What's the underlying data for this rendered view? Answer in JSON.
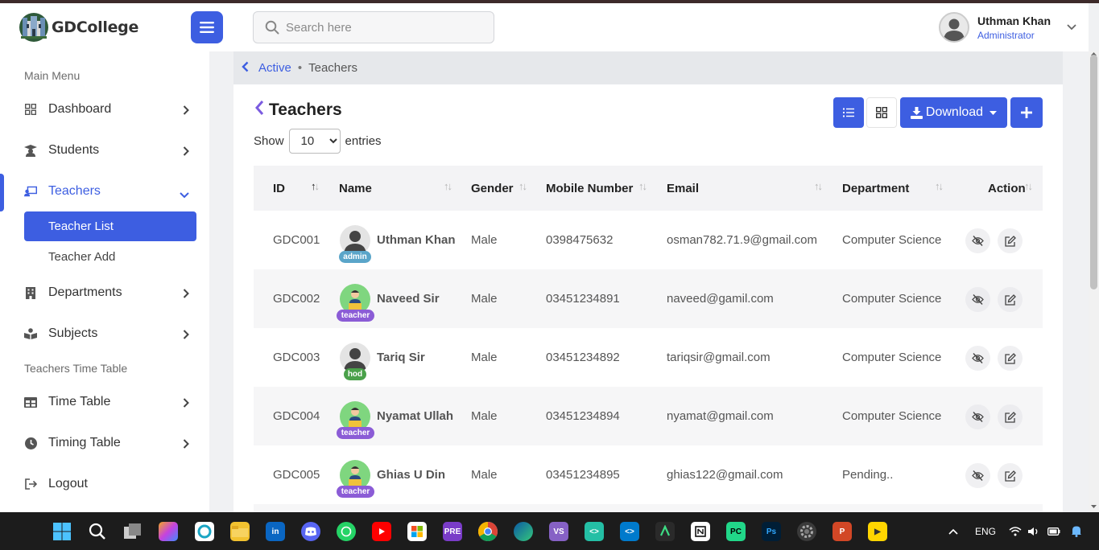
{
  "app": {
    "logo_text": "GDCollege"
  },
  "search": {
    "placeholder": "Search here"
  },
  "user": {
    "name": "Uthman Khan",
    "role": "Administrator"
  },
  "sidebar": {
    "section_main": "Main Menu",
    "section_timetable": "Teachers Time Table",
    "items": [
      {
        "label": "Dashboard"
      },
      {
        "label": "Students"
      },
      {
        "label": "Teachers"
      },
      {
        "label": "Departments"
      },
      {
        "label": "Subjects"
      },
      {
        "label": "Time Table"
      },
      {
        "label": "Timing Table"
      },
      {
        "label": "Logout"
      }
    ],
    "sub_items": [
      {
        "label": "Teacher List"
      },
      {
        "label": "Teacher Add"
      }
    ]
  },
  "breadcrumb": {
    "active": "Active",
    "separator": "•",
    "current": "Teachers"
  },
  "page": {
    "title": "Teachers",
    "show_label": "Show",
    "entries_value": "10",
    "entries_label": "entries",
    "download_label": "Download"
  },
  "table": {
    "columns": [
      "ID",
      "Name",
      "Gender",
      "Mobile Number",
      "Email",
      "Department",
      "Action"
    ],
    "rows": [
      {
        "id": "GDC001",
        "name": "Uthman Khan",
        "badge": "admin",
        "gender": "Male",
        "mobile": "0398475632",
        "email": "osman782.71.9@gmail.com",
        "department": "Computer Science"
      },
      {
        "id": "GDC002",
        "name": "Naveed Sir",
        "badge": "teacher",
        "gender": "Male",
        "mobile": "03451234891",
        "email": "naveed@gamil.com",
        "department": "Computer Science"
      },
      {
        "id": "GDC003",
        "name": "Tariq Sir",
        "badge": "hod",
        "gender": "Male",
        "mobile": "03451234892",
        "email": "tariqsir@gmail.com",
        "department": "Computer Science"
      },
      {
        "id": "GDC004",
        "name": "Nyamat Ullah",
        "badge": "teacher",
        "gender": "Male",
        "mobile": "03451234894",
        "email": "nyamat@gmail.com",
        "department": "Computer Science"
      },
      {
        "id": "GDC005",
        "name": "Ghias U Din",
        "badge": "teacher",
        "gender": "Male",
        "mobile": "03451234895",
        "email": "ghias122@gmail.com",
        "department": "Pending.."
      }
    ]
  },
  "taskbar": {
    "language": "ENG"
  },
  "colors": {
    "primary": "#3d5ee1",
    "badge_admin": "#5aa5c9",
    "badge_teacher": "#8b5cd6",
    "badge_hod": "#4aa14a"
  }
}
